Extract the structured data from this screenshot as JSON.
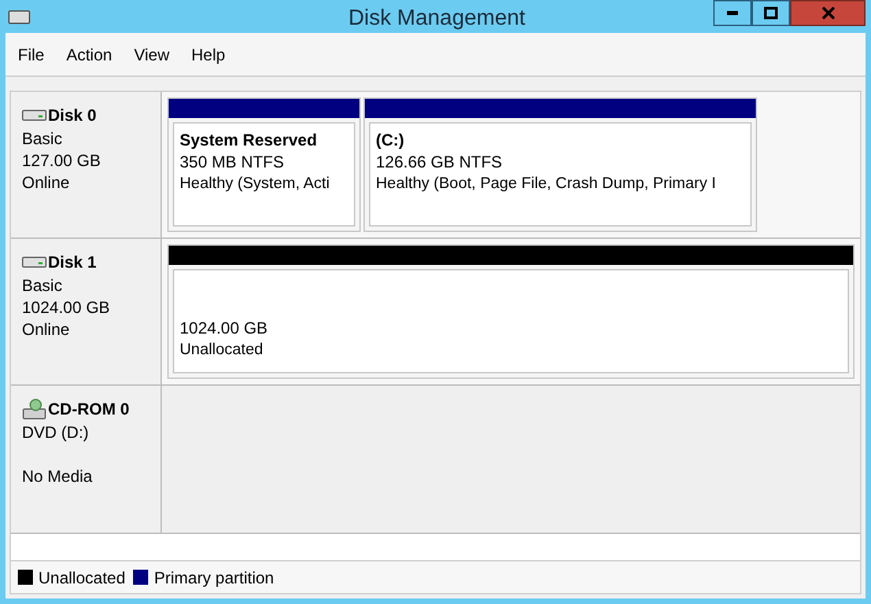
{
  "window": {
    "title": "Disk Management"
  },
  "menu": [
    "File",
    "Action",
    "View",
    "Help"
  ],
  "disks": [
    {
      "kind": "disk",
      "name": "Disk 0",
      "lines": [
        "Basic",
        "127.00 GB",
        "Online"
      ],
      "partitions": [
        {
          "name": "System Reserved",
          "size": "350 MB NTFS",
          "status": "Healthy (System, Acti",
          "color": "#000080"
        },
        {
          "name": "(C:)",
          "size": "126.66 GB NTFS",
          "status": "Healthy (Boot, Page File, Crash Dump, Primary I",
          "color": "#000080"
        }
      ]
    },
    {
      "kind": "disk",
      "name": "Disk 1",
      "lines": [
        "Basic",
        "1024.00 GB",
        "Online"
      ],
      "partitions": [
        {
          "size": "1024.00 GB",
          "status": "Unallocated",
          "color": "#000000"
        }
      ]
    },
    {
      "kind": "cdrom",
      "name": "CD-ROM 0",
      "lines": [
        "DVD (D:)"
      ],
      "status": "No Media"
    }
  ],
  "legend": [
    {
      "label": "Unallocated",
      "color": "#000000"
    },
    {
      "label": "Primary partition",
      "color": "#000080"
    }
  ]
}
